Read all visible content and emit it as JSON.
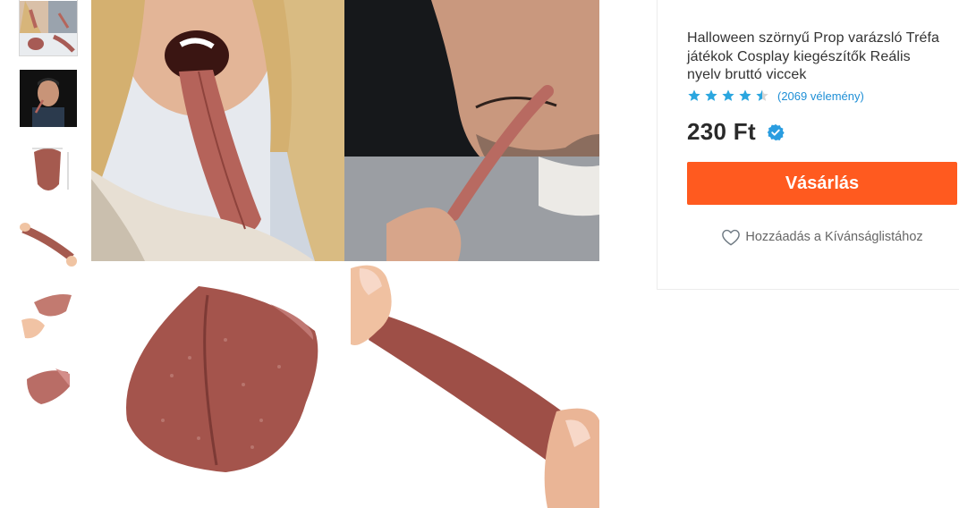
{
  "thumbnails": [
    {
      "name": "thumb-woman-tongue",
      "active": true
    },
    {
      "name": "thumb-man-tongue"
    },
    {
      "name": "thumb-tongue-measure"
    },
    {
      "name": "thumb-tongue-stretch"
    },
    {
      "name": "thumb-tongue-hand"
    },
    {
      "name": "thumb-tongue-prop"
    }
  ],
  "product": {
    "title": "Halloween szörnyű Prop varázsló Tréfa játékok Cosplay kiegészítők Reális nyelv bruttó viccek",
    "rating": 4.5,
    "reviews": "(2069 vélemény)",
    "price": "230 Ft",
    "buy_label": "Vásárlás",
    "wishlist_label": "Hozzáadás a Kívánságlistához"
  },
  "colors": {
    "buy_button": "#ff5a1f",
    "star": "#2aa6df",
    "verified": "#2a9de0",
    "review_link": "#1e8fd6"
  },
  "icons": {
    "star": "star-icon",
    "verified": "verified-check-icon",
    "wishlist": "heart-icon"
  }
}
